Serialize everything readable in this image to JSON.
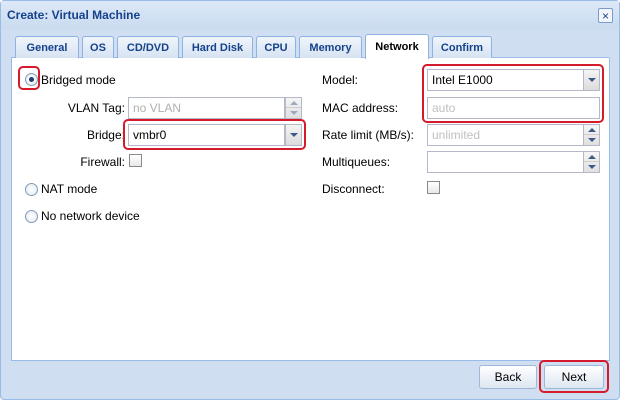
{
  "window": {
    "title": "Create: Virtual Machine"
  },
  "tabs": [
    {
      "label": "General"
    },
    {
      "label": "OS"
    },
    {
      "label": "CD/DVD"
    },
    {
      "label": "Hard Disk"
    },
    {
      "label": "CPU"
    },
    {
      "label": "Memory"
    },
    {
      "label": "Network",
      "active": true
    },
    {
      "label": "Confirm"
    }
  ],
  "network": {
    "bridged_mode": {
      "label": "Bridged mode",
      "checked": true
    },
    "vlan_tag": {
      "label": "VLAN Tag:",
      "placeholder": "no VLAN"
    },
    "bridge": {
      "label": "Bridge:",
      "value": "vmbr0"
    },
    "firewall": {
      "label": "Firewall:",
      "checked": false
    },
    "nat_mode": {
      "label": "NAT mode",
      "checked": false
    },
    "no_network": {
      "label": "No network device",
      "checked": false
    },
    "model": {
      "label": "Model:",
      "value": "Intel E1000"
    },
    "mac_address": {
      "label": "MAC address:",
      "placeholder": "auto"
    },
    "rate_limit": {
      "label": "Rate limit (MB/s):",
      "placeholder": "unlimited"
    },
    "multiqueues": {
      "label": "Multiqueues:",
      "value": ""
    },
    "disconnect": {
      "label": "Disconnect:",
      "checked": false
    }
  },
  "footer": {
    "back_label": "Back",
    "next_label": "Next"
  },
  "colors": {
    "highlight": "#d51a2b",
    "title_text": "#15428b",
    "window_bg": "#cfdff1"
  },
  "icons": {
    "close": "close-icon",
    "dropdown": "chevron-down-icon",
    "spinner_up": "caret-up-icon",
    "spinner_down": "caret-down-icon"
  }
}
